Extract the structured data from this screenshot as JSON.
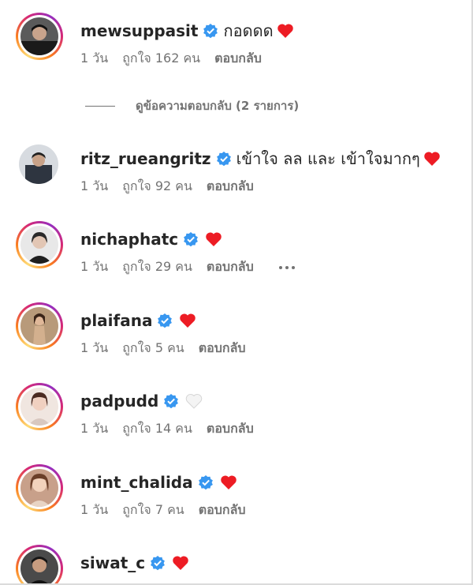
{
  "colors": {
    "accent_verified": "#3897f0",
    "meta_text": "#737373",
    "text": "#262626",
    "heart_red": "#ed1c24"
  },
  "comments": [
    {
      "username": "mewsuppasit",
      "verified": true,
      "text": "กอดดด",
      "reaction": "red-heart-icon",
      "time": "1 วัน",
      "likes": "ถูกใจ 162 คน",
      "reply": "ตอบกลับ"
    },
    {
      "username": "ritz_rueangritz",
      "verified": true,
      "text": "เข้าใจ ลล และ เข้าใจมากๆ",
      "reaction": "red-heart-icon",
      "time": "1 วัน",
      "likes": "ถูกใจ 92 คน",
      "reply": "ตอบกลับ"
    },
    {
      "username": "nichaphatc",
      "verified": true,
      "text": "",
      "reaction": "red-heart-icon",
      "time": "1 วัน",
      "likes": "ถูกใจ 29 คน",
      "reply": "ตอบกลับ"
    },
    {
      "username": "plaifana",
      "verified": true,
      "text": "",
      "reaction": "red-heart-icon",
      "time": "1 วัน",
      "likes": "ถูกใจ 5 คน",
      "reply": "ตอบกลับ"
    },
    {
      "username": "padpudd",
      "verified": true,
      "text": "",
      "reaction": "white-heart-icon",
      "time": "1 วัน",
      "likes": "ถูกใจ 14 คน",
      "reply": "ตอบกลับ"
    },
    {
      "username": "mint_chalida",
      "verified": true,
      "text": "",
      "reaction": "red-heart-icon",
      "time": "1 วัน",
      "likes": "ถูกใจ 7 คน",
      "reply": "ตอบกลับ"
    },
    {
      "username": "siwat_c",
      "verified": true,
      "text": "",
      "reaction": "red-heart-icon"
    }
  ],
  "view_replies": "ดูข้อความตอบกลับ (2 รายการ)"
}
